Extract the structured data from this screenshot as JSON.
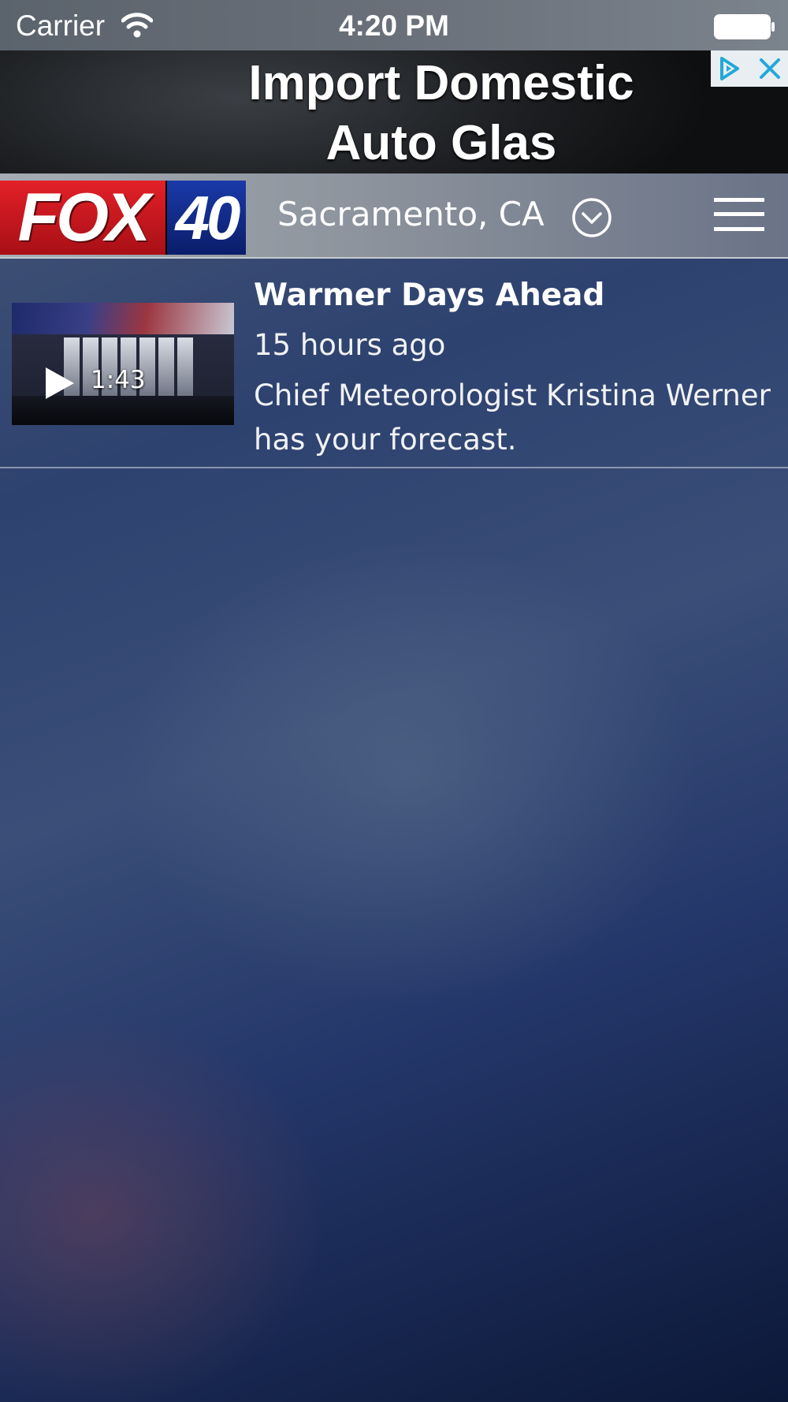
{
  "status_bar": {
    "carrier": "Carrier",
    "time": "4:20 PM"
  },
  "ad": {
    "headline": "Import Domestic Auto Glas",
    "choices_icon": "adchoices-icon",
    "close_icon": "close-icon"
  },
  "header": {
    "logo": {
      "word": "FOX",
      "number": "40"
    },
    "location": "Sacramento, CA",
    "location_dropdown_icon": "chevron-down-circle-icon",
    "menu_icon": "hamburger-menu-icon"
  },
  "stories": [
    {
      "title": "Warmer Days Ahead",
      "time": "15 hours ago",
      "description": "Chief Meteorologist Kristina Werner has your forecast.",
      "duration": "1:43"
    }
  ]
}
